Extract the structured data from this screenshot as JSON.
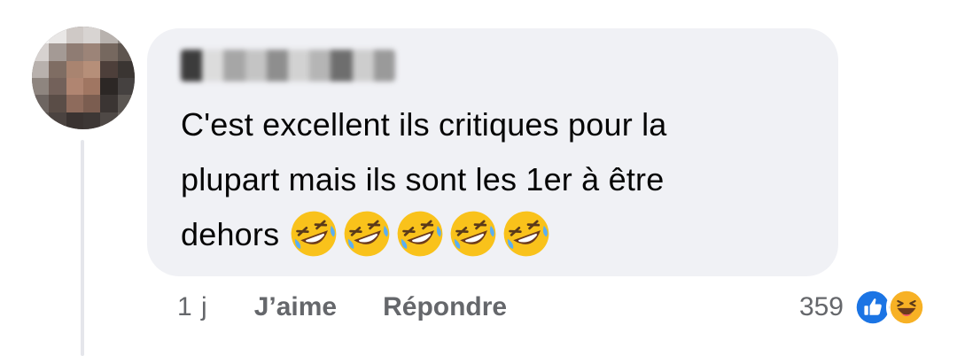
{
  "comment": {
    "author": "",
    "lines": [
      "C'est excellent ils critiques pour la",
      "plupart mais ils sont les 1er à être",
      "dehors"
    ],
    "emojis": [
      "rofl-emoji",
      "rofl-emoji",
      "rofl-emoji",
      "rofl-emoji",
      "rofl-emoji"
    ]
  },
  "actions": {
    "timestamp": "1 j",
    "like_label": "J’aime",
    "reply_label": "Répondre"
  },
  "reactions": {
    "count": "359",
    "icons": [
      "like-icon",
      "haha-icon"
    ]
  },
  "colors": {
    "bubble": "#f0f1f5",
    "text": "#050505",
    "secondary_text": "#65676b",
    "like_blue": "#1b74e4",
    "haha_yellow": "#f7b125"
  }
}
